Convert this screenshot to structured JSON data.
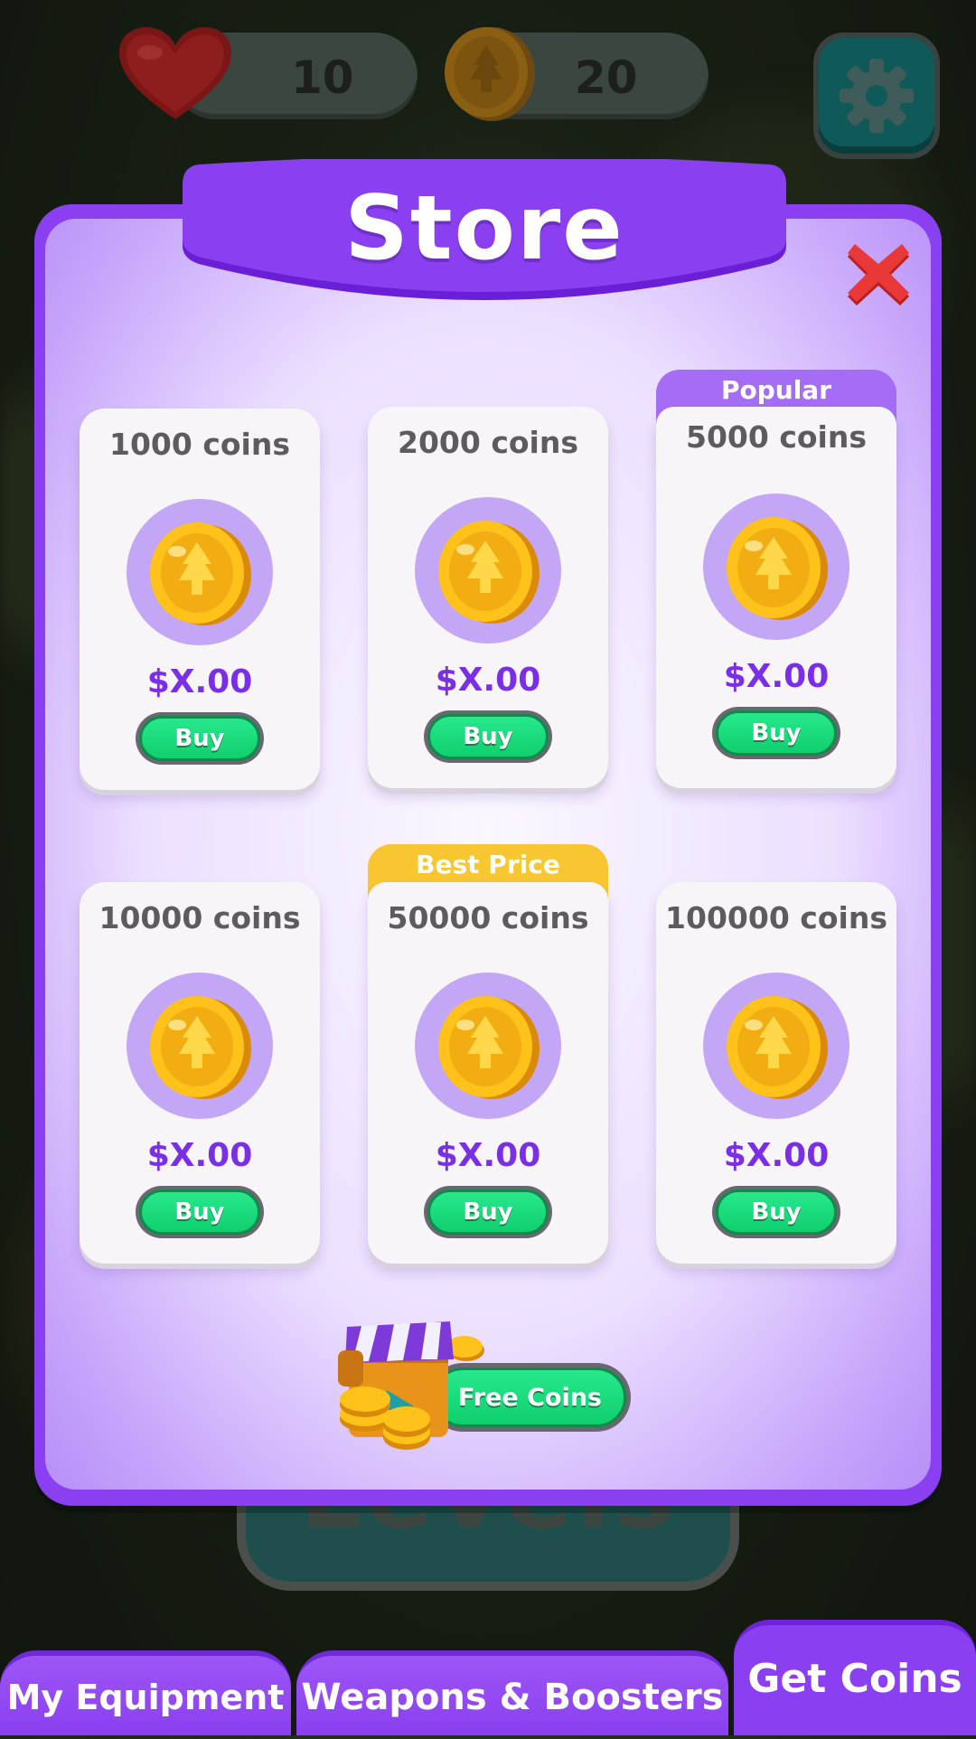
{
  "hud": {
    "lives": "10",
    "coins": "20"
  },
  "store": {
    "title": "Store"
  },
  "packs": [
    {
      "title": "1000 coins",
      "price": "$X.00",
      "buy_label": "Buy",
      "ribbon": ""
    },
    {
      "title": "2000 coins",
      "price": "$X.00",
      "buy_label": "Buy",
      "ribbon": ""
    },
    {
      "title": "5000 coins",
      "price": "$X.00",
      "buy_label": "Buy",
      "ribbon": "Popular"
    },
    {
      "title": "10000 coins",
      "price": "$X.00",
      "buy_label": "Buy",
      "ribbon": ""
    },
    {
      "title": "50000 coins",
      "price": "$X.00",
      "buy_label": "Buy",
      "ribbon": "Best Price"
    },
    {
      "title": "100000 coins",
      "price": "$X.00",
      "buy_label": "Buy",
      "ribbon": ""
    }
  ],
  "free_coins": {
    "label": "Free Coins"
  },
  "background": {
    "levels_label": "Levels"
  },
  "tabs": [
    {
      "label": "My Equipment",
      "active": false
    },
    {
      "label": "Weapons & Boosters",
      "active": false
    },
    {
      "label": "Get Coins",
      "active": true
    }
  ],
  "colors": {
    "panel": "#8a3ff0",
    "buy_button": "#1fe07f",
    "popular_ribbon": "#a56df6",
    "best_price_ribbon": "#f7c630",
    "price_text": "#7a2fe6"
  }
}
